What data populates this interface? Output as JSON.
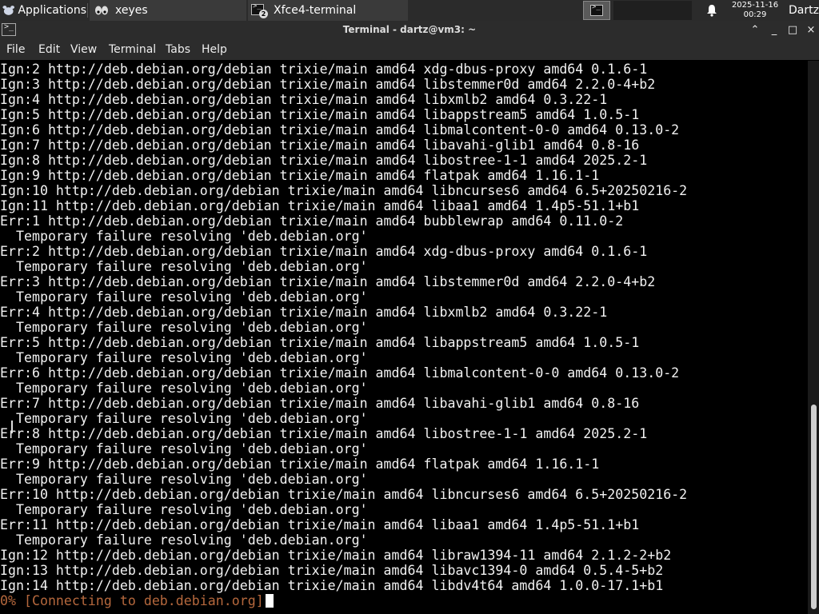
{
  "panel": {
    "applications_label": "Applications",
    "tasks": [
      {
        "label": "xeyes",
        "icon": "xeyes-icon"
      },
      {
        "label": "Xfce4-terminal",
        "icon": "terminal-icon",
        "badge": "2"
      }
    ],
    "clock": {
      "date": "2025-11-16",
      "time": "00:29"
    },
    "user": "Dartz"
  },
  "window": {
    "title": "Terminal - dartz@vm3: ~",
    "controls": {
      "shade": "⌃",
      "minimize": "_",
      "maximize": "□",
      "close": "×"
    }
  },
  "menu": {
    "items": [
      "File",
      "Edit",
      "View",
      "Terminal",
      "Tabs",
      "Help"
    ]
  },
  "terminal": {
    "lines": [
      "Ign:2 http://deb.debian.org/debian trixie/main amd64 xdg-dbus-proxy amd64 0.1.6-1",
      "Ign:3 http://deb.debian.org/debian trixie/main amd64 libstemmer0d amd64 2.2.0-4+b2",
      "Ign:4 http://deb.debian.org/debian trixie/main amd64 libxmlb2 amd64 0.3.22-1",
      "Ign:5 http://deb.debian.org/debian trixie/main amd64 libappstream5 amd64 1.0.5-1",
      "Ign:6 http://deb.debian.org/debian trixie/main amd64 libmalcontent-0-0 amd64 0.13.0-2",
      "Ign:7 http://deb.debian.org/debian trixie/main amd64 libavahi-glib1 amd64 0.8-16",
      "Ign:8 http://deb.debian.org/debian trixie/main amd64 libostree-1-1 amd64 2025.2-1",
      "Ign:9 http://deb.debian.org/debian trixie/main amd64 flatpak amd64 1.16.1-1",
      "Ign:10 http://deb.debian.org/debian trixie/main amd64 libncurses6 amd64 6.5+20250216-2",
      "Ign:11 http://deb.debian.org/debian trixie/main amd64 libaa1 amd64 1.4p5-51.1+b1",
      "Err:1 http://deb.debian.org/debian trixie/main amd64 bubblewrap amd64 0.11.0-2",
      "  Temporary failure resolving 'deb.debian.org'",
      "Err:2 http://deb.debian.org/debian trixie/main amd64 xdg-dbus-proxy amd64 0.1.6-1",
      "  Temporary failure resolving 'deb.debian.org'",
      "Err:3 http://deb.debian.org/debian trixie/main amd64 libstemmer0d amd64 2.2.0-4+b2",
      "  Temporary failure resolving 'deb.debian.org'",
      "Err:4 http://deb.debian.org/debian trixie/main amd64 libxmlb2 amd64 0.3.22-1",
      "  Temporary failure resolving 'deb.debian.org'",
      "Err:5 http://deb.debian.org/debian trixie/main amd64 libappstream5 amd64 1.0.5-1",
      "  Temporary failure resolving 'deb.debian.org'",
      "Err:6 http://deb.debian.org/debian trixie/main amd64 libmalcontent-0-0 amd64 0.13.0-2",
      "  Temporary failure resolving 'deb.debian.org'",
      "Err:7 http://deb.debian.org/debian trixie/main amd64 libavahi-glib1 amd64 0.8-16",
      "  Temporary failure resolving 'deb.debian.org'",
      "Err:8 http://deb.debian.org/debian trixie/main amd64 libostree-1-1 amd64 2025.2-1",
      "  Temporary failure resolving 'deb.debian.org'",
      "Err:9 http://deb.debian.org/debian trixie/main amd64 flatpak amd64 1.16.1-1",
      "  Temporary failure resolving 'deb.debian.org'",
      "Err:10 http://deb.debian.org/debian trixie/main amd64 libncurses6 amd64 6.5+20250216-2",
      "  Temporary failure resolving 'deb.debian.org'",
      "Err:11 http://deb.debian.org/debian trixie/main amd64 libaa1 amd64 1.4p5-51.1+b1",
      "  Temporary failure resolving 'deb.debian.org'",
      "Ign:12 http://deb.debian.org/debian trixie/main amd64 libraw1394-11 amd64 2.1.2-2+b2",
      "Ign:13 http://deb.debian.org/debian trixie/main amd64 libavc1394-0 amd64 0.5.4-5+b2",
      "Ign:14 http://deb.debian.org/debian trixie/main amd64 libdv4t64 amd64 1.0.0-17.1+b1"
    ],
    "progress_line": "0% [Connecting to deb.debian.org]",
    "colors": {
      "background": "#000000",
      "foreground": "#f2f2f2",
      "progress": "#b5683d"
    }
  }
}
